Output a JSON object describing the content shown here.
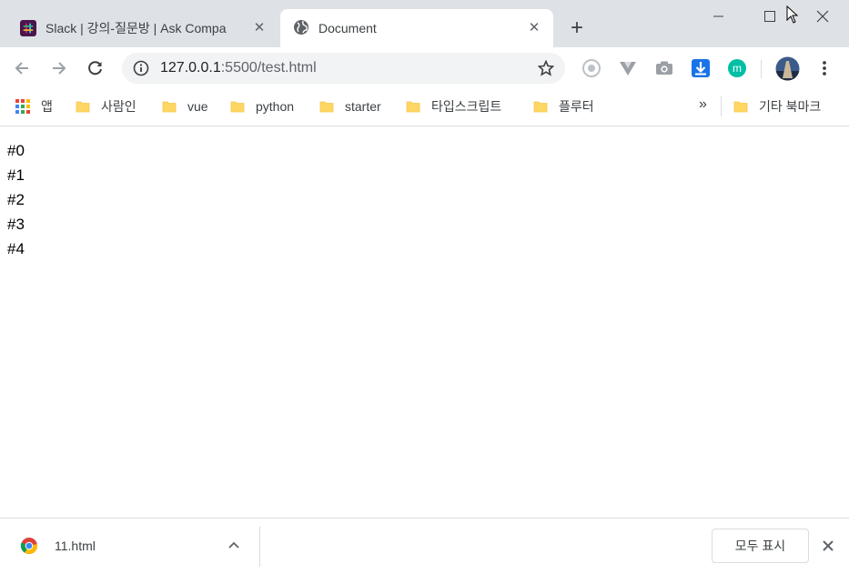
{
  "tabs": [
    {
      "title": "Slack | 강의-질문방 | Ask Compa",
      "favicon": "slack-icon",
      "active": false
    },
    {
      "title": "Document",
      "favicon": "globe-icon",
      "active": true
    }
  ],
  "toolbar": {
    "url_host": "127.0.0.1",
    "url_path": ":5500/test.html"
  },
  "bookmarks": {
    "apps_label": "앱",
    "items": [
      "사람인",
      "vue",
      "python",
      "starter",
      "타입스크립트",
      "플루터"
    ],
    "overflow": "»",
    "other_label": "기타 북마크"
  },
  "content": {
    "lines": [
      "#0",
      "#1",
      "#2",
      "#3",
      "#4"
    ]
  },
  "download": {
    "filename": "11.html",
    "show_all_label": "모두 표시"
  },
  "colors": {
    "tabstrip": "#dee1e6",
    "slack": "#4a154b",
    "folder": "#fdd663",
    "download_arrow": "#1a73e8",
    "ext_teal": "#00bfa5"
  }
}
